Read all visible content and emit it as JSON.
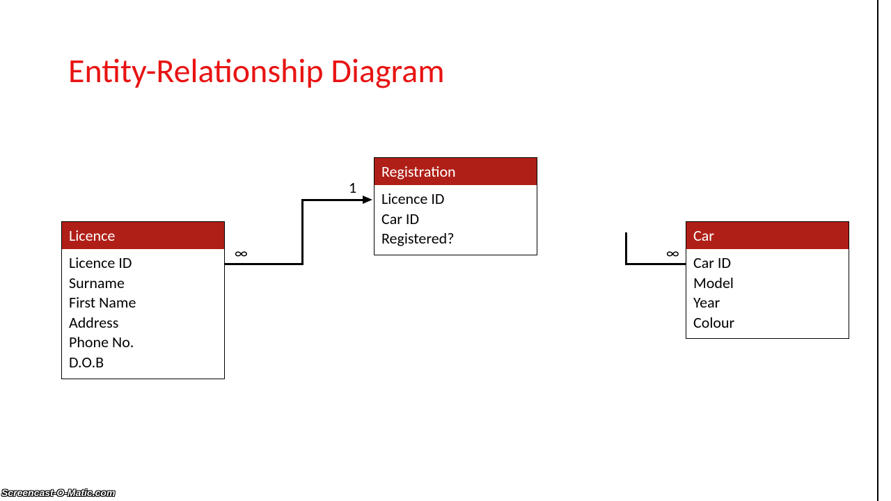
{
  "title": "Entity-Relationship Diagram",
  "entities": {
    "licence": {
      "name": "Licence",
      "attrs": [
        "Licence ID",
        "Surname",
        "First Name",
        "Address",
        "Phone No.",
        "D.O.B"
      ]
    },
    "registration": {
      "name": "Registration",
      "attrs": [
        "Licence ID",
        "Car ID",
        "Registered?"
      ]
    },
    "car": {
      "name": "Car",
      "attrs": [
        "Car ID",
        "Model",
        "Year",
        "Colour"
      ]
    }
  },
  "cardinality": {
    "licence_side": "∞",
    "registration_side": "1",
    "car_side": "∞"
  },
  "watermark": "Screencast-O-Matic.com"
}
